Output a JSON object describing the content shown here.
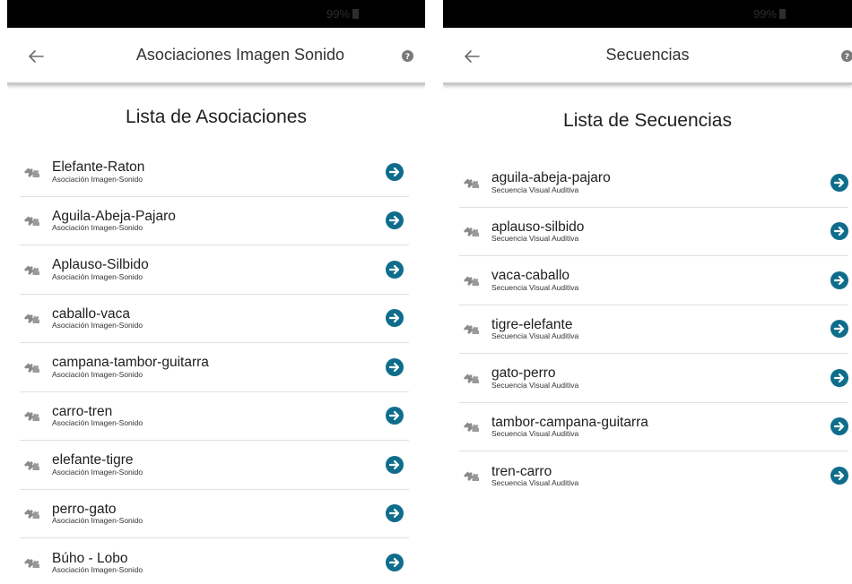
{
  "left": {
    "status": {
      "battery": "99%"
    },
    "appbar": {
      "title": "Asociaciones Imagen Sonido"
    },
    "heading": "Lista de Asociaciones",
    "items": [
      {
        "name": "Elefante-Raton",
        "sub": "Asociación Imagen-Sonido"
      },
      {
        "name": "Aguila-Abeja-Pajaro",
        "sub": "Asociación Imagen-Sonido"
      },
      {
        "name": "Aplauso-Silbido",
        "sub": "Asociación Imagen-Sonido"
      },
      {
        "name": "caballo-vaca",
        "sub": "Asociación Imagen-Sonido"
      },
      {
        "name": "campana-tambor-guitarra",
        "sub": "Asociación Imagen-Sonido"
      },
      {
        "name": "carro-tren",
        "sub": "Asociación Imagen-Sonido"
      },
      {
        "name": "elefante-tigre",
        "sub": "Asociación Imagen-Sonido"
      },
      {
        "name": "perro-gato",
        "sub": "Asociación Imagen-Sonido"
      },
      {
        "name": "Búho - Lobo",
        "sub": "Asociación Imagen-Sonido"
      }
    ]
  },
  "right": {
    "status": {
      "battery": "99%"
    },
    "appbar": {
      "title": "Secuencias"
    },
    "heading": "Lista de Secuencias",
    "items": [
      {
        "name": "aguila-abeja-pajaro",
        "sub": "Secuencia Visual Auditiva"
      },
      {
        "name": "aplauso-silbido",
        "sub": "Secuencia Visual Auditiva"
      },
      {
        "name": "vaca-caballo",
        "sub": "Secuencia Visual Auditiva"
      },
      {
        "name": "tigre-elefante",
        "sub": "Secuencia Visual Auditiva"
      },
      {
        "name": "gato-perro",
        "sub": "Secuencia Visual Auditiva"
      },
      {
        "name": "tambor-campana-guitarra",
        "sub": "Secuencia Visual Auditiva"
      },
      {
        "name": "tren-carro",
        "sub": "Secuencia Visual Auditiva"
      }
    ]
  },
  "colors": {
    "accent": "#0f6d8c",
    "icon_gray": "#8a8a8a",
    "divider": "#e0e0e0"
  },
  "icons": {
    "back": "arrow-left-icon",
    "help": "question-circle-icon",
    "item": "puzzle-piece-icon",
    "go": "arrow-circle-right-icon"
  }
}
